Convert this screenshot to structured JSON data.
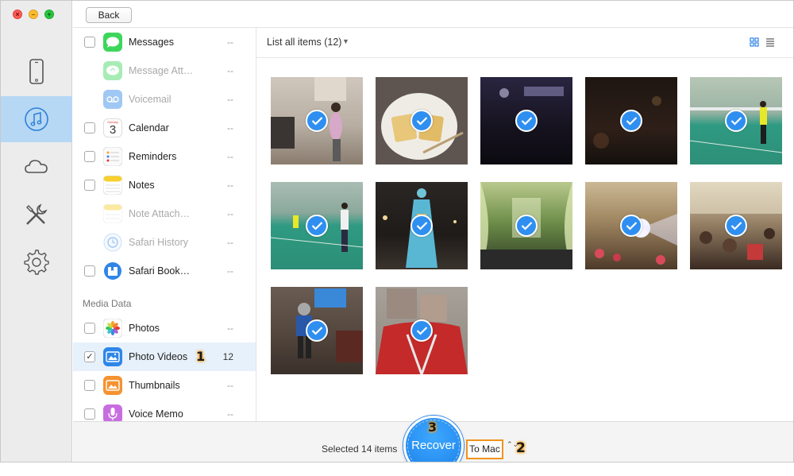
{
  "window": {
    "traffic_lights": {
      "close": "×",
      "minimize": "–",
      "zoom": "+"
    }
  },
  "toolbar": {
    "back_label": "Back"
  },
  "rail": {
    "items": [
      {
        "name": "device",
        "icon": "iphone-icon"
      },
      {
        "name": "itunes",
        "icon": "music-note-icon",
        "active": true
      },
      {
        "name": "icloud",
        "icon": "cloud-icon"
      },
      {
        "name": "tools",
        "icon": "tools-icon"
      },
      {
        "name": "settings",
        "icon": "gear-icon"
      }
    ]
  },
  "categories": {
    "items": [
      {
        "label": "Messages",
        "count": "--",
        "enabled": true,
        "icon": "messages-icon"
      },
      {
        "label": "Message Att…",
        "count": "--",
        "enabled": false,
        "icon": "message-attachments-icon"
      },
      {
        "label": "Voicemail",
        "count": "--",
        "enabled": false,
        "icon": "voicemail-icon"
      },
      {
        "label": "Calendar",
        "count": "--",
        "enabled": true,
        "icon": "calendar-icon",
        "icon_text": "3",
        "icon_day": "Sunday"
      },
      {
        "label": "Reminders",
        "count": "--",
        "enabled": true,
        "icon": "reminders-icon"
      },
      {
        "label": "Notes",
        "count": "--",
        "enabled": true,
        "icon": "notes-icon"
      },
      {
        "label": "Note Attach…",
        "count": "--",
        "enabled": false,
        "icon": "note-attachments-icon"
      },
      {
        "label": "Safari History",
        "count": "--",
        "enabled": false,
        "icon": "safari-history-icon"
      },
      {
        "label": "Safari Book…",
        "count": "--",
        "enabled": true,
        "icon": "safari-bookmarks-icon"
      }
    ],
    "section_heading": "Media Data",
    "media_items": [
      {
        "label": "Photos",
        "count": "--",
        "enabled": true,
        "icon": "photos-icon"
      },
      {
        "label": "Photo Videos",
        "count": "12",
        "enabled": true,
        "selected": true,
        "checked": "✓",
        "icon": "photo-videos-icon",
        "annotation": "1"
      },
      {
        "label": "Thumbnails",
        "count": "--",
        "enabled": true,
        "icon": "thumbnails-icon"
      },
      {
        "label": "Voice Memo",
        "count": "--",
        "enabled": true,
        "icon": "voice-memo-icon"
      }
    ]
  },
  "main": {
    "filter_label": "List all items (12)",
    "filter_caret": "▼",
    "view_modes": [
      "grid-view-icon",
      "list-view-icon"
    ],
    "thumbnails": [
      {
        "scene": "room-person-mopping",
        "checked": true
      },
      {
        "scene": "plate-of-food",
        "checked": true
      },
      {
        "scene": "dark-stage",
        "checked": true
      },
      {
        "scene": "dark-banquet",
        "checked": true
      },
      {
        "scene": "badminton-court-player",
        "checked": true
      },
      {
        "scene": "badminton-court-players",
        "checked": true
      },
      {
        "scene": "night-performer-costume",
        "checked": true
      },
      {
        "scene": "wedding-hall-green",
        "checked": true
      },
      {
        "scene": "banquet-hall-lights",
        "checked": true
      },
      {
        "scene": "banquet-guests",
        "checked": true
      },
      {
        "scene": "living-room-child",
        "checked": true
      },
      {
        "scene": "child-red-jacket",
        "checked": true
      }
    ]
  },
  "bottom": {
    "selected_text": "Selected 14 items",
    "recover_label": "Recover",
    "recover_annotation": "3",
    "destination": "To Mac",
    "destination_annotation": "2",
    "stepper": "⌃⌄"
  },
  "colors": {
    "accent": "#2f8ff0",
    "rail_active": "#b6d8f4",
    "selected_row": "#e7f1fb",
    "annotation_border": "#f0931c"
  }
}
